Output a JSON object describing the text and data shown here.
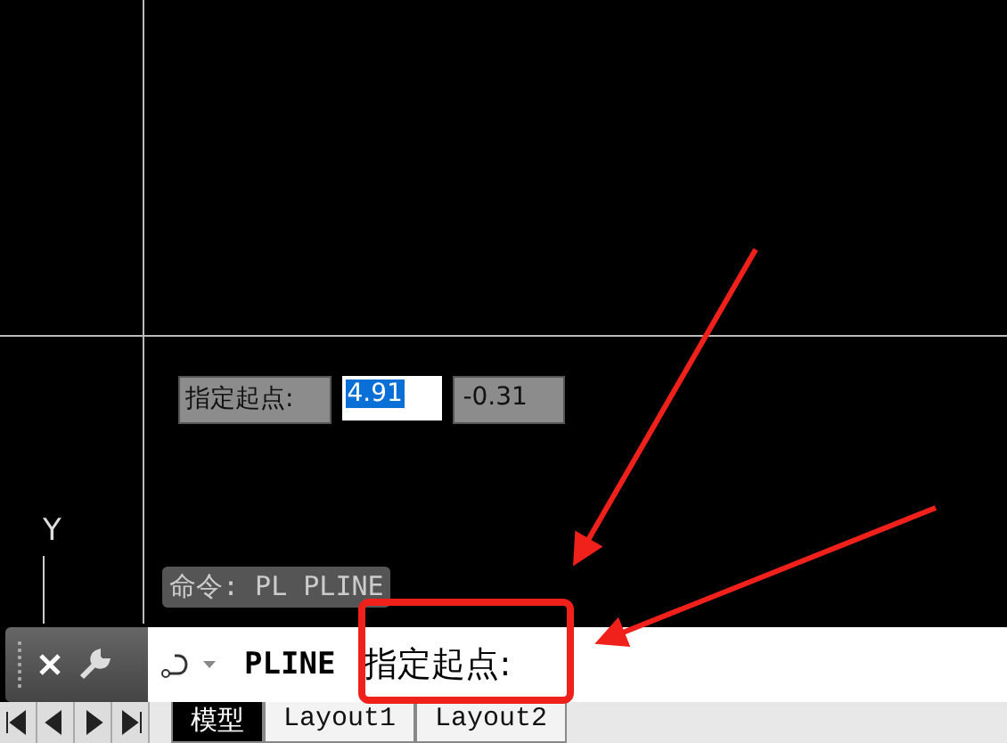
{
  "canvas": {
    "axis_label": "Y",
    "dynamic_input": {
      "prompt": "指定起点:",
      "x_value": "4.91",
      "x_selected": true,
      "y_value": "-0.31"
    },
    "command_history": "命令: PL PLINE"
  },
  "command_line": {
    "command": "PLINE",
    "prompt": "指定起点:"
  },
  "layout_tabs": [
    {
      "label": "模型",
      "selected": true
    },
    {
      "label": "Layout1",
      "selected": false
    },
    {
      "label": "Layout2",
      "selected": false
    }
  ]
}
